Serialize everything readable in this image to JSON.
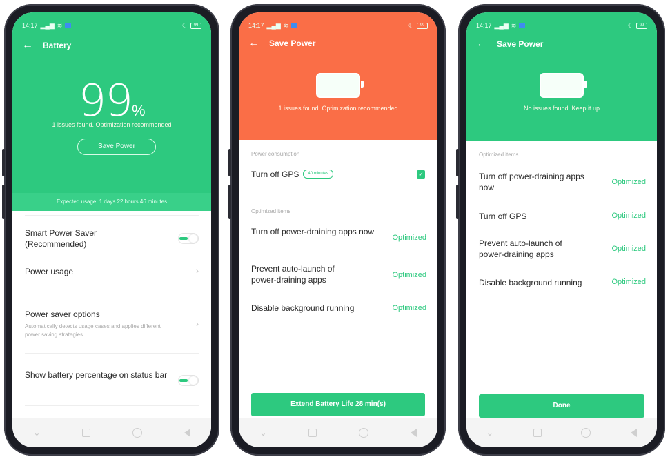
{
  "status_bar": {
    "time": "14:17",
    "battery_level": "99"
  },
  "screen1": {
    "title": "Battery",
    "percent_value": "99",
    "percent_sign": "%",
    "issues": "1 issues found. Optimization recommended",
    "save_button": "Save Power",
    "expected_usage": "Expected usage: 1 days 22 hours 46 minutes",
    "items": [
      {
        "title": "Smart Power Saver (Recommended)",
        "toggle": true
      },
      {
        "title": "Power usage"
      },
      {
        "title": "Power saver options",
        "sub": "Automatically detects usage cases and applies different power saving strategies."
      },
      {
        "title": "Show battery percentage on status bar",
        "toggle": true
      }
    ],
    "accent": "#2dc97f"
  },
  "screen2": {
    "title": "Save Power",
    "issues": "1 issues found. Optimization recommended",
    "section_consumption": "Power consumption",
    "gps_label": "Turn off GPS",
    "gps_tag": "40 minutes",
    "section_optimized": "Optimized items",
    "items": [
      {
        "title": "Turn off power-draining apps now",
        "status": "Optimized"
      },
      {
        "title": "Prevent auto-launch of power-draining apps",
        "status": "Optimized"
      },
      {
        "title": "Disable background running",
        "status": "Optimized"
      }
    ],
    "cta": "Extend Battery Life 28 min(s)",
    "header_color": "#fa6e47"
  },
  "screen3": {
    "title": "Save Power",
    "message": "No issues found. Keep it up",
    "section_optimized": "Optimized items",
    "items": [
      {
        "title": "Turn off power-draining apps now",
        "status": "Optimized"
      },
      {
        "title": "Turn off GPS",
        "status": "Optimized"
      },
      {
        "title": "Prevent auto-launch of power-draining apps",
        "status": "Optimized"
      },
      {
        "title": "Disable background running",
        "status": "Optimized"
      }
    ],
    "cta": "Done"
  },
  "icons": {
    "back": "arrow-left-icon",
    "chevron": "chevron-right-icon",
    "nav": [
      "chevron-down-icon",
      "square-icon",
      "circle-icon",
      "triangle-back-icon"
    ]
  }
}
